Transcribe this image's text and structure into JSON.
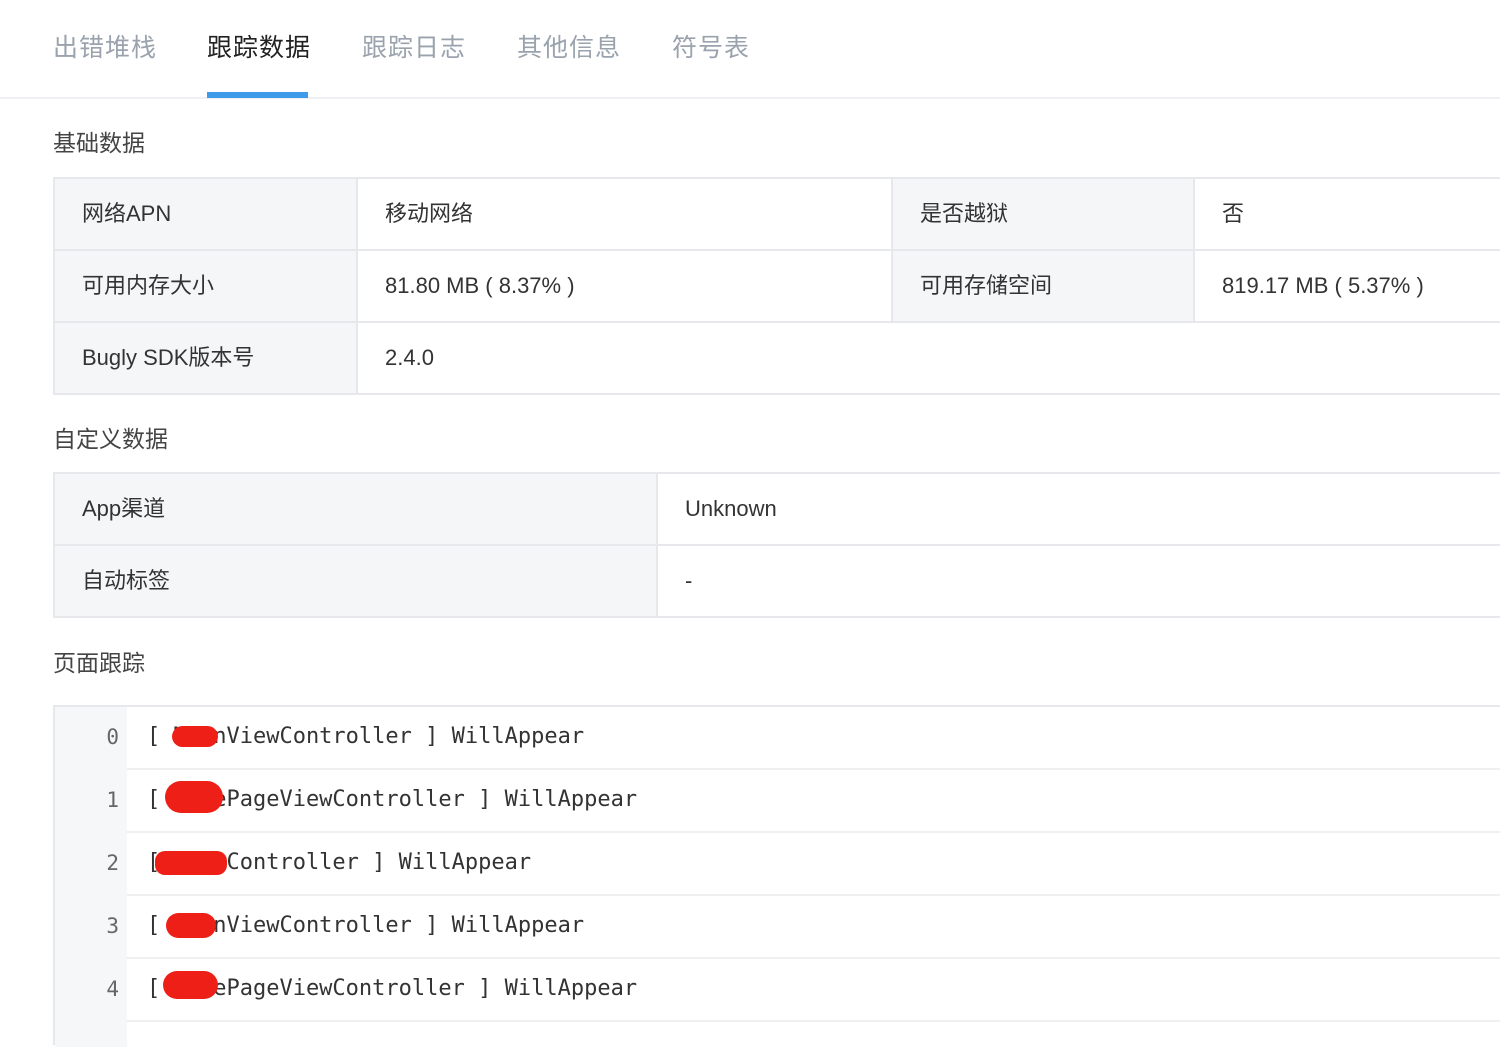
{
  "tabs": [
    {
      "label": "出错堆栈",
      "active": false
    },
    {
      "label": "跟踪数据",
      "active": true
    },
    {
      "label": "跟踪日志",
      "active": false
    },
    {
      "label": "其他信息",
      "active": false
    },
    {
      "label": "符号表",
      "active": false
    }
  ],
  "colors": {
    "accent": "#3d9be9",
    "redaction": "#ee1f16",
    "label_bg": "#f5f6f8"
  },
  "basic": {
    "title": "基础数据",
    "rows": [
      {
        "k1": "网络APN",
        "v1": "移动网络",
        "k2": "是否越狱",
        "v2": "否"
      },
      {
        "k1": "可用内存大小",
        "v1": "81.80 MB ( 8.37% )",
        "k2": "可用存储空间",
        "v2": "819.17 MB ( 5.37% )"
      },
      {
        "k1": "Bugly SDK版本号",
        "v1": "2.4.0"
      }
    ]
  },
  "custom": {
    "title": "自定义数据",
    "rows": [
      {
        "k": "App渠道",
        "v": "Unknown"
      },
      {
        "k": "自动标签",
        "v": "-"
      }
    ]
  },
  "trace": {
    "title": "页面跟踪",
    "rows": [
      {
        "no": "0",
        "text": "[ MainViewController ] WillAppear"
      },
      {
        "no": "1",
        "text": "[ HomePageViewController ] WillAppear"
      },
      {
        "no": "2",
        "text": "[ ViewController ] WillAppear"
      },
      {
        "no": "3",
        "text": "[ MainViewController ] WillAppear"
      },
      {
        "no": "4",
        "text": "[ HomePageViewController ] WillAppear"
      }
    ]
  }
}
